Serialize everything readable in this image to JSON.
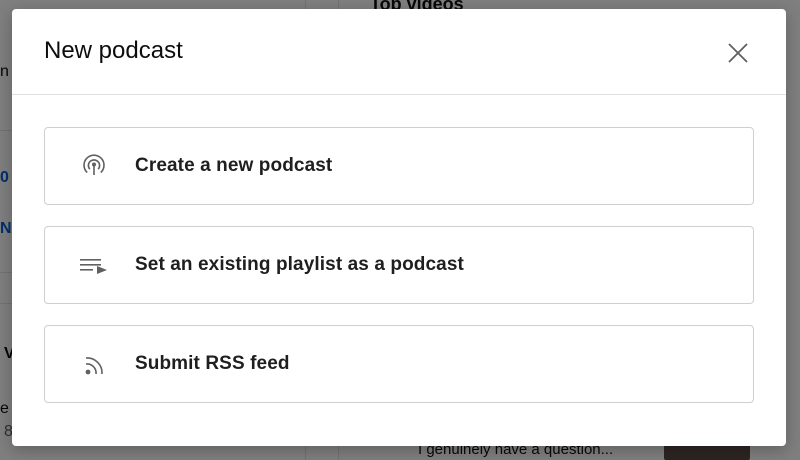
{
  "background": {
    "heading": "Top videos",
    "left_fragments": [
      "n",
      "0",
      "N",
      "V",
      "e",
      "8"
    ],
    "comment_text": "I genuinely have a question..."
  },
  "dialog": {
    "title": "New podcast",
    "close_icon": "close-icon",
    "options": [
      {
        "label": "Create a new podcast",
        "icon": "podcast-icon"
      },
      {
        "label": "Set an existing playlist as a podcast",
        "icon": "playlist-icon"
      },
      {
        "label": "Submit RSS feed",
        "icon": "rss-feed-icon"
      }
    ]
  },
  "colors": {
    "scrim": "#000000",
    "border": "#cfcfcf",
    "text": "#1f1f1f",
    "icon": "#606060"
  }
}
